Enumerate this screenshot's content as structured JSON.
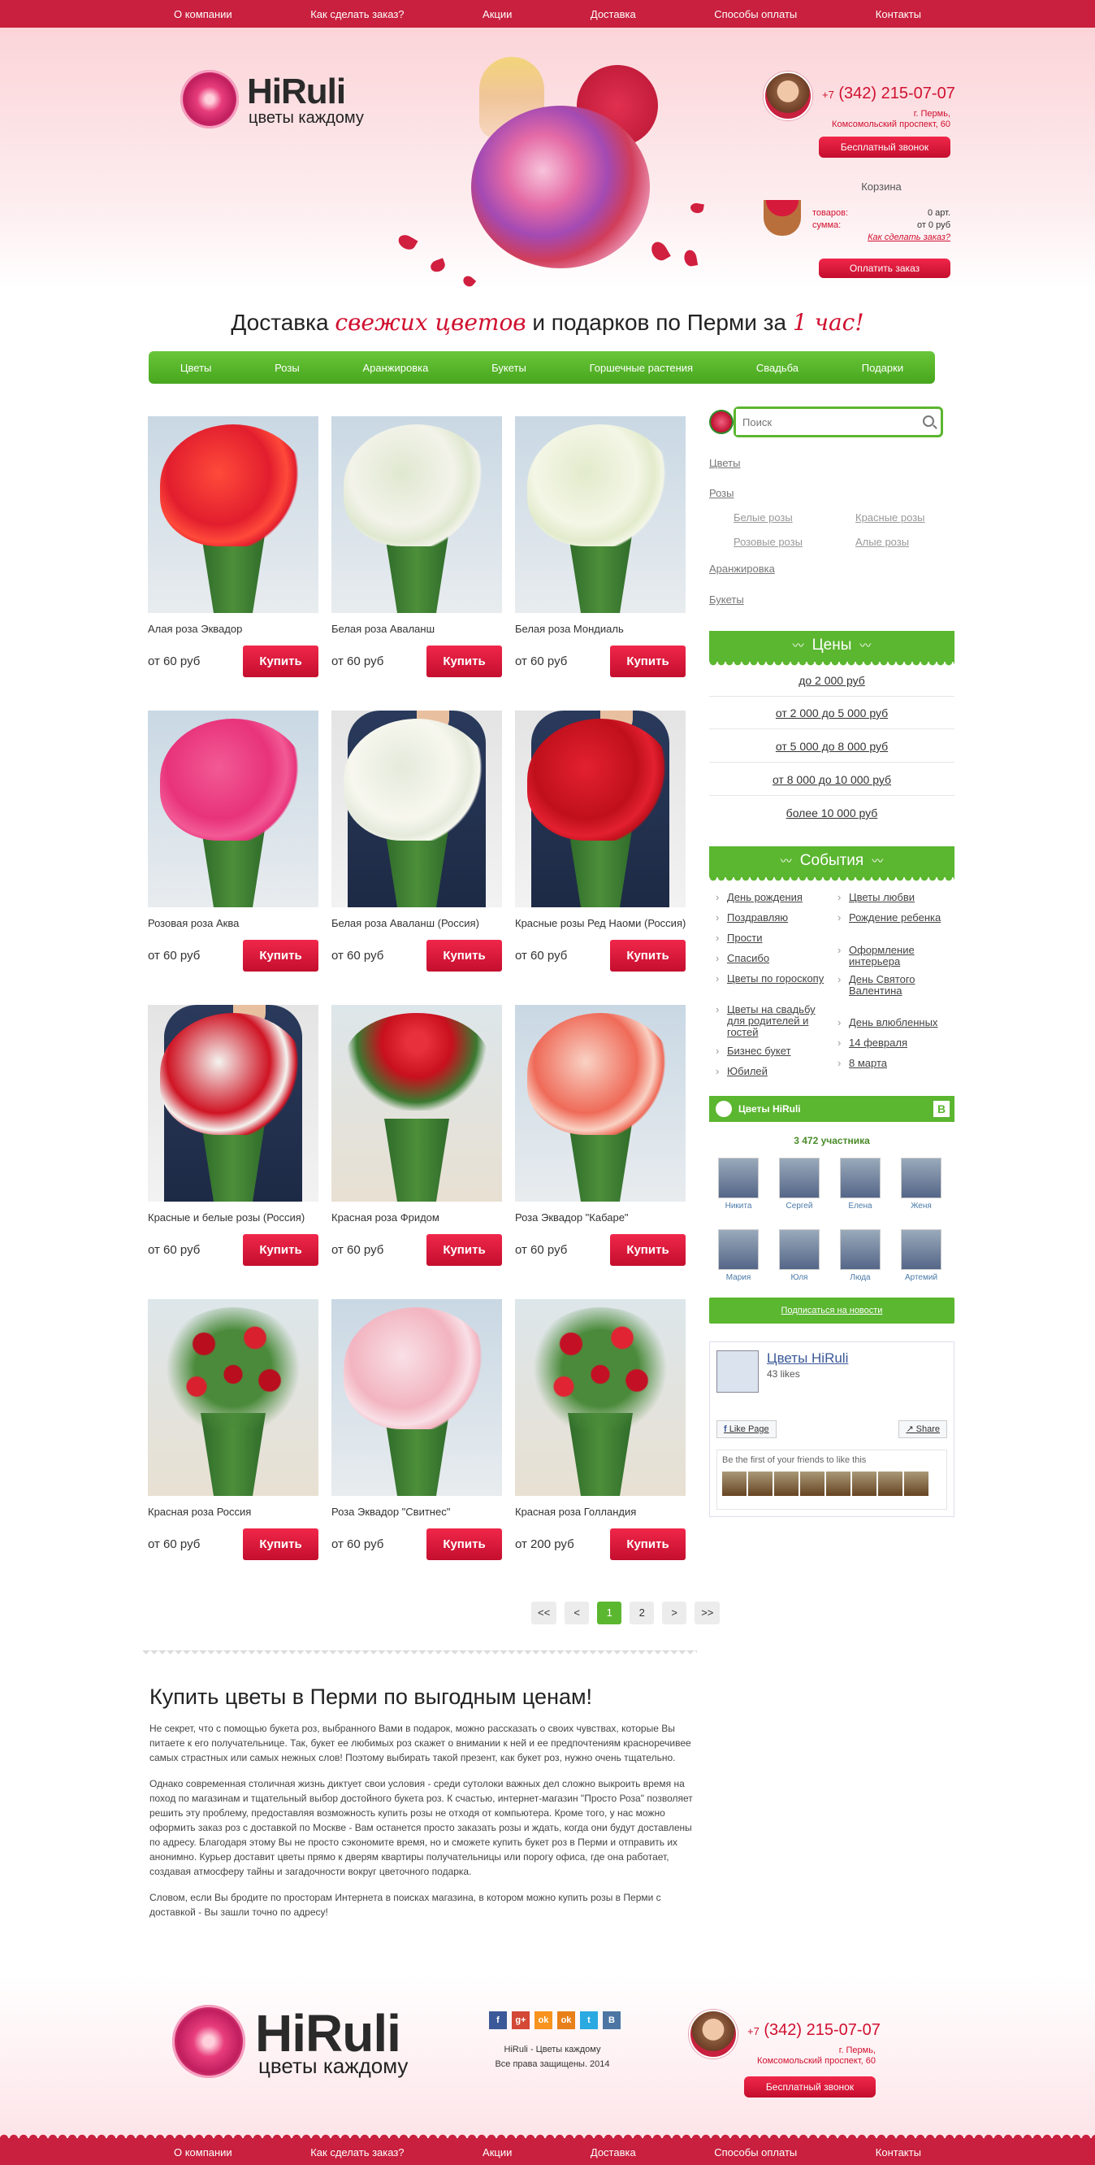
{
  "nav": [
    "О компании",
    "Как сделать заказ?",
    "Акции",
    "Доставка",
    "Способы оплаты",
    "Контакты"
  ],
  "logo": {
    "name": "HiRuli",
    "tagline": "цветы каждому"
  },
  "contact": {
    "phone_prefix": "+7",
    "phone": "(342) 215-07-07",
    "city": "г. Пермь,",
    "address": "Комсомольский проспект, 60",
    "call_button": "Бесплатный звонок"
  },
  "cart": {
    "title": "Корзина",
    "items_label": "товаров:",
    "items_value": "0 арт.",
    "sum_label": "сумма:",
    "sum_value": "от 0 руб",
    "howto": "Как сделать заказ?",
    "pay_button": "Оплатить заказ"
  },
  "slogan": {
    "part1": "Доставка",
    "accent1": "свежих цветов",
    "part2": "и подарков по Перми за",
    "accent2": "1 час!"
  },
  "menu": [
    "Цветы",
    "Розы",
    "Аранжировка",
    "Букеты",
    "Горшечные растения",
    "Свадьба",
    "Подарки"
  ],
  "buy_label": "Купить",
  "products": [
    {
      "name": "Алая роза Эквадор",
      "price": "от 60 руб",
      "colors": [
        "#e21e2e",
        "#ff4a3a"
      ],
      "style": "plain"
    },
    {
      "name": "Белая роза Аваланш",
      "price": "от 60 руб",
      "colors": [
        "#f3f3ea",
        "#dfe8d0"
      ],
      "style": "plain"
    },
    {
      "name": "Белая роза Мондиаль",
      "price": "от 60 руб",
      "colors": [
        "#f4f6e6",
        "#e2ebcc"
      ],
      "style": "plain"
    },
    {
      "name": "Розовая роза Аква",
      "price": "от 60 руб",
      "colors": [
        "#e8337a",
        "#f25a95"
      ],
      "style": "plain"
    },
    {
      "name": "Белая роза Аваланш (Россия)",
      "price": "от 60 руб",
      "colors": [
        "#f7f7ee",
        "#e5eadc"
      ],
      "style": "man"
    },
    {
      "name": "Красные розы Ред Наоми (Россия)",
      "price": "от 60 руб",
      "colors": [
        "#c0101c",
        "#e32030"
      ],
      "style": "man"
    },
    {
      "name": "Красные и белые розы (Россия)",
      "price": "от 60 руб",
      "colors": [
        "#cf1424",
        "#f4f4f0"
      ],
      "style": "man"
    },
    {
      "name": "Красная роза Фридом",
      "price": "от 60 руб",
      "colors": [
        "#c8101e",
        "#e8303c"
      ],
      "style": "tall"
    },
    {
      "name": "Роза Эквадор \"Кабаре\"",
      "price": "от 60 руб",
      "colors": [
        "#ef6a58",
        "#f9d2c4"
      ],
      "style": "plain"
    },
    {
      "name": "Красная роза Россия",
      "price": "от 60 руб",
      "colors": [
        "#b80e1e",
        "#d8202e"
      ],
      "style": "sparse"
    },
    {
      "name": "Роза Эквадор \"Свитнес\"",
      "price": "от 60 руб",
      "colors": [
        "#f2b4c0",
        "#f9e0e6"
      ],
      "style": "plain"
    },
    {
      "name": "Красная роза Голландия",
      "price": "от 200 руб",
      "colors": [
        "#c41024",
        "#e02434"
      ],
      "style": "sparse"
    }
  ],
  "pagination": [
    "<<",
    "<",
    "1",
    "2",
    ">",
    ">>"
  ],
  "seo": {
    "title": "Купить цветы в Перми по выгодным ценам!",
    "p1": "Не секрет, что с помощью букета роз, выбранного Вами в подарок, можно рассказать о своих чувствах, которые Вы питаете к его получательнице. Так, букет ее любимых роз скажет о внимании к ней и ее предпочтениям красноречивее самых страстных или самых нежных слов! Поэтому выбирать такой презент, как букет роз, нужно очень тщательно.",
    "p2": "Однако современная столичная жизнь диктует свои условия - среди сутолоки важных дел сложно выкроить время на поход по магазинам и тщательный выбор достойного букета роз. К счастью, интернет-магазин \"Просто Роза\" позволяет решить эту проблему, предоставляя возможность купить розы не отходя от компьютера. Кроме того, у нас можно оформить заказ роз с доставкой по Москве - Вам останется просто заказать розы и ждать, когда они будут доставлены по адресу. Благодаря этому Вы не просто сэкономите время, но и сможете купить букет роз в Перми и отправить их анонимно. Курьер доставит цветы прямо к дверям квартиры получательницы или порогу офиса, где она работает, создавая атмосферу тайны и загадочности вокруг цветочного подарка.",
    "p3": "Словом, если Вы бродите по просторам Интернета в поисках магазина, в котором можно купить розы в Перми с доставкой - Вы зашли точно по адресу!"
  },
  "sidebar": {
    "search_placeholder": "Поиск",
    "cat_flowers": "Цветы",
    "cat_roses": "Розы",
    "roses_sub": [
      "Белые розы",
      "Красные розы",
      "Розовые розы",
      "Алые розы"
    ],
    "cat_arrangement": "Аранжировка",
    "cat_bouquets": "Букеты",
    "prices_title": "Цены",
    "prices": [
      "до 2 000 руб",
      "от 2 000 до 5 000 руб",
      "от 5 000 до 8 000 руб",
      "от 8 000 до 10 000 руб",
      "более 10 000 руб"
    ],
    "events_title": "События",
    "events_left": [
      "День рождения",
      "Поздравляю",
      "Прости",
      "Спасибо",
      "Цветы по гороскопу",
      "Цветы на свадьбу для родителей и гостей",
      "Бизнес букет",
      "Юбилей"
    ],
    "events_right": [
      "Цветы любви",
      "Рождение ребенка",
      "Оформление интерьера",
      "День Святого Валентина",
      "День влюбленных",
      "14 февраля",
      "8 марта"
    ],
    "vk": {
      "title": "Цветы HiRuli",
      "badge": "В",
      "count": "3 472 участника",
      "members": [
        "Никита",
        "Сергей",
        "Елена",
        "Женя",
        "Мария",
        "Юля",
        "Люда",
        "Артемий"
      ],
      "subscribe": "Подписаться на новости"
    },
    "fb": {
      "title": "Цветы HiRuli",
      "likes": "43 likes",
      "like_button": "Like Page",
      "share_button": "Share",
      "friends_text": "Be the first of your friends to like this"
    }
  },
  "footer": {
    "copy1": "HiRuli - Цветы каждому",
    "copy2": "Все права защищены. 2014",
    "social": [
      "f",
      "g+",
      "ok",
      "ok",
      "t",
      "B"
    ]
  },
  "colors": {
    "brand_red": "#c8203e",
    "accent_green": "#5bb630"
  }
}
